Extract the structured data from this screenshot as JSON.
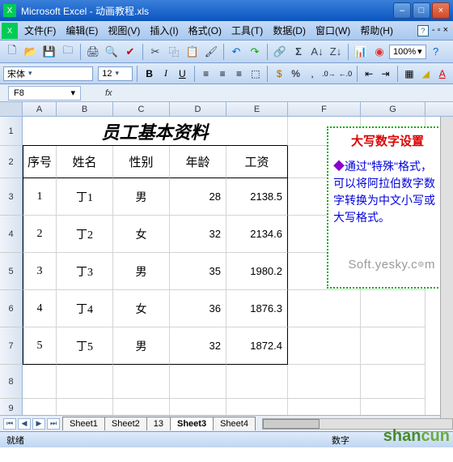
{
  "window": {
    "title": "Microsoft Excel - 动画教程.xls"
  },
  "menu": {
    "file": "文件(F)",
    "edit": "编辑(E)",
    "view": "视图(V)",
    "insert": "插入(I)",
    "format": "格式(O)",
    "tools": "工具(T)",
    "data": "数据(D)",
    "window": "窗口(W)",
    "help": "帮助(H)"
  },
  "toolbar": {
    "zoom": "100%"
  },
  "format": {
    "font": "宋体",
    "size": "12"
  },
  "cellref": "F8",
  "columns": [
    "A",
    "B",
    "C",
    "D",
    "E",
    "F",
    "G"
  ],
  "rowCount": 9,
  "sheet": {
    "title": "员工基本资料",
    "headers": [
      "序号",
      "姓名",
      "性别",
      "年龄",
      "工资"
    ],
    "rows": [
      [
        "1",
        "丁1",
        "男",
        "28",
        "2138.5"
      ],
      [
        "2",
        "丁2",
        "女",
        "32",
        "2134.6"
      ],
      [
        "3",
        "丁3",
        "男",
        "35",
        "1980.2"
      ],
      [
        "4",
        "丁4",
        "女",
        "36",
        "1876.3"
      ],
      [
        "5",
        "丁5",
        "男",
        "32",
        "1872.4"
      ]
    ]
  },
  "callout": {
    "title": "大写数字设置",
    "body1": "通过\"特殊\"格式，可以将阿拉伯数字数字转换为中文小写或大写格式。"
  },
  "watermark": "Soft.yesky.c",
  "tabs": [
    "Sheet1",
    "Sheet2",
    "13",
    "Sheet3",
    "Sheet4"
  ],
  "activeTab": 3,
  "status": {
    "left": "就绪",
    "right": "数字"
  },
  "logo": {
    "p1": "shan",
    "p2": "cun"
  }
}
